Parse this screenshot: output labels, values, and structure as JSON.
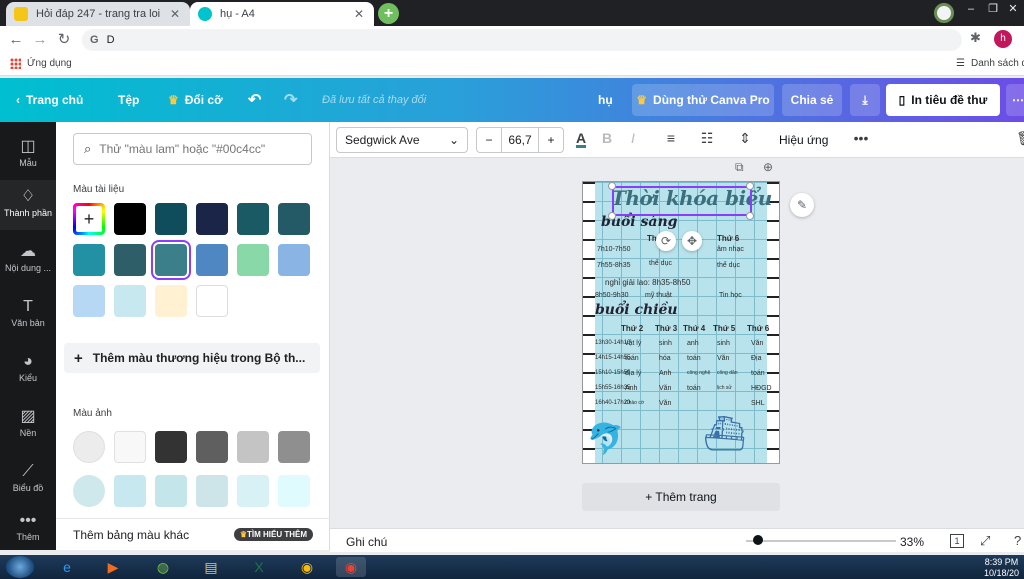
{
  "browser": {
    "tabs": [
      {
        "title": "Hỏi đáp 247 - trang tra loi",
        "favicon_color": "#f5c518"
      },
      {
        "title": "hụ - A4",
        "favicon_color": "#00c4cc"
      }
    ],
    "new_tab_icon": "plus-icon",
    "address": "D",
    "address_prefix": "G",
    "bookmarks": {
      "apps_label": "Ứng dụng",
      "reading_list": "Danh sách đ"
    },
    "profile_initial": "h"
  },
  "canva_header": {
    "home": "Trang chủ",
    "file": "Tệp",
    "resize": "Đổi cỡ",
    "saved_status": "Đã lưu tất cả thay đổi",
    "doc_title": "hụ",
    "try_pro": "Dùng thử Canva Pro",
    "share": "Chia sẻ",
    "print": "In tiêu đề thư"
  },
  "rail": [
    {
      "label": "Mẫu",
      "icon": "layout-icon"
    },
    {
      "label": "Thành phần",
      "icon": "elements-icon"
    },
    {
      "label": "Nội dung ...",
      "icon": "upload-icon"
    },
    {
      "label": "Văn bản",
      "icon": "text-icon"
    },
    {
      "label": "Kiểu",
      "icon": "palette-icon"
    },
    {
      "label": "Nền",
      "icon": "background-icon"
    },
    {
      "label": "Biểu đồ",
      "icon": "chart-icon"
    },
    {
      "label": "Thêm",
      "icon": "more-icon"
    }
  ],
  "panel": {
    "search_placeholder": "Thử \"màu lam\" hoặc \"#00c4cc\"",
    "doc_colors_label": "Màu tài liệu",
    "doc_colors": [
      "#000000",
      "#0f4c5c",
      "#1b2547",
      "#1a5a64",
      "#235a66",
      "#2291a3",
      "#2e5e67",
      "#3a7f8a",
      "#4f87c2",
      "#88d8a8",
      "#8ab4e3",
      "#b6d8f4",
      "#c6e8ee",
      "#fff1d2",
      "#ffffff"
    ],
    "selected_color": "#3a7f8a",
    "brand_button": "Thêm màu thương hiệu trong Bộ th...",
    "photo_colors_label": "Màu ảnh",
    "photo_colors": [
      "#ececec",
      "#f8f8f8",
      "#333333",
      "#5f5f5f",
      "#c4c4c4",
      "#8f8f8f",
      "#cfe8ec",
      "#c6e8ee",
      "#c4e6ea",
      "#cde4e8",
      "#d8f1f5",
      "#e0fbfd"
    ],
    "more_palettes": "Thêm bảng màu khác",
    "learn_more": "TÌM HIỂU THÊM"
  },
  "toolbar": {
    "font": "Sedgwick Ave",
    "size": "66,7",
    "effects": "Hiệu ứng"
  },
  "page": {
    "title": "Thời khóa biểu",
    "morning": "buổi sáng",
    "afternoon": "buổi chiều",
    "morning_days": [
      "Thứ 5",
      "Thứ 6"
    ],
    "morning_rows": [
      {
        "time": "7h10-7h50",
        "thu5": "",
        "thu6": "âm nhạc"
      },
      {
        "time": "7h55-8h35",
        "thu5": "thể dục",
        "thu6": "thể dục"
      },
      {
        "time": "8h50-9h30",
        "thu5": "mỹ thuật",
        "thu6": "Tin học"
      }
    ],
    "break_text": "nghỉ giải lao: 8h35-8h50",
    "afternoon_days": [
      "Thứ 2",
      "Thứ 3",
      "Thứ 4",
      "Thứ 5",
      "Thứ 6"
    ],
    "afternoon_rows": [
      {
        "time": "13h30-14h10",
        "cells": [
          "vật lý",
          "sinh",
          "anh",
          "sinh",
          "Văn"
        ]
      },
      {
        "time": "14h15-14h55",
        "cells": [
          "toán",
          "hóa",
          "toán",
          "Văn",
          "Địa"
        ]
      },
      {
        "time": "15h10-15h50",
        "cells": [
          "địa lý",
          "Anh",
          "công nghệ",
          "công dân",
          "toán"
        ]
      },
      {
        "time": "15h55-16h35",
        "cells": [
          "Anh",
          "Văn",
          "toán",
          "lịch sử",
          "HĐGD"
        ]
      },
      {
        "time": "16h40-17h20",
        "cells": [
          "Chào cờ",
          "Văn",
          "",
          "",
          "SHL"
        ]
      }
    ]
  },
  "add_page": "+ Thêm trang",
  "status": {
    "notes": "Ghi chú",
    "zoom": "33%",
    "page_num": "1",
    "zoom_fraction": 0.33
  },
  "taskbar": {
    "time": "8:39 PM",
    "date": "10/18/20"
  }
}
